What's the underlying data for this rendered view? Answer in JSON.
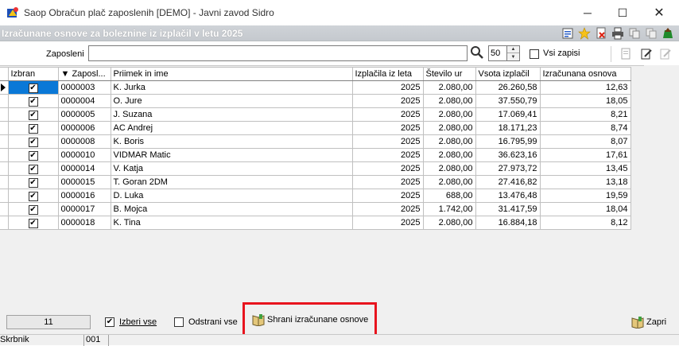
{
  "window": {
    "title": "Saop Obračun plač zaposlenih [DEMO] - Javni zavod Sidro"
  },
  "form": {
    "title": "Izračunane osnove za boleznine iz izplačil v letu 2025"
  },
  "filter": {
    "label": "Zaposleni",
    "search_value": "",
    "limit": "50",
    "all_records_label": "Vsi zapisi",
    "all_records_checked": false
  },
  "table": {
    "columns": [
      "Izbran",
      "Zaposl...",
      "Priimek in ime",
      "Izplačila iz leta",
      "Število ur",
      "Vsota izplačil",
      "Izračunana osnova"
    ],
    "rows": [
      {
        "checked": "✔",
        "id": "0000003",
        "name": "K. Jurka",
        "year": "2025",
        "hours": "2.080,00",
        "sum": "26.260,58",
        "base": "12,63"
      },
      {
        "checked": "✔",
        "id": "0000004",
        "name": "O. Jure",
        "year": "2025",
        "hours": "2.080,00",
        "sum": "37.550,79",
        "base": "18,05"
      },
      {
        "checked": "✔",
        "id": "0000005",
        "name": "J. Suzana",
        "year": "2025",
        "hours": "2.080,00",
        "sum": "17.069,41",
        "base": "8,21"
      },
      {
        "checked": "✔",
        "id": "0000006",
        "name": "AC Andrej",
        "year": "2025",
        "hours": "2.080,00",
        "sum": "18.171,23",
        "base": "8,74"
      },
      {
        "checked": "✔",
        "id": "0000008",
        "name": "K. Boris",
        "year": "2025",
        "hours": "2.080,00",
        "sum": "16.795,99",
        "base": "8,07"
      },
      {
        "checked": "✔",
        "id": "0000010",
        "name": "VIDMAR Matic",
        "year": "2025",
        "hours": "2.080,00",
        "sum": "36.623,16",
        "base": "17,61"
      },
      {
        "checked": "✔",
        "id": "0000014",
        "name": "V. Katja",
        "year": "2025",
        "hours": "2.080,00",
        "sum": "27.973,72",
        "base": "13,45"
      },
      {
        "checked": "✔",
        "id": "0000015",
        "name": "T. Goran 2DM",
        "year": "2025",
        "hours": "2.080,00",
        "sum": "27.416,82",
        "base": "13,18"
      },
      {
        "checked": "✔",
        "id": "0000016",
        "name": "D. Luka",
        "year": "2025",
        "hours": "688,00",
        "sum": "13.476,48",
        "base": "19,59"
      },
      {
        "checked": "✔",
        "id": "0000017",
        "name": "B.  Mojca",
        "year": "2025",
        "hours": "1.742,00",
        "sum": "31.417,59",
        "base": "18,04"
      },
      {
        "checked": "✔",
        "id": "0000018",
        "name": "K. Tina",
        "year": "2025",
        "hours": "2.080,00",
        "sum": "16.884,18",
        "base": "8,12"
      }
    ]
  },
  "footer": {
    "count": "11",
    "select_all_label": "Izberi vse",
    "select_all_checked": true,
    "select_all_mark": "✔",
    "deselect_label": "Odstrani vse",
    "deselect_checked": false,
    "save_label": "Shrani izračunane osnove",
    "close_label": "Zapri"
  },
  "status": {
    "user": "Skrbnik",
    "code": "001"
  }
}
